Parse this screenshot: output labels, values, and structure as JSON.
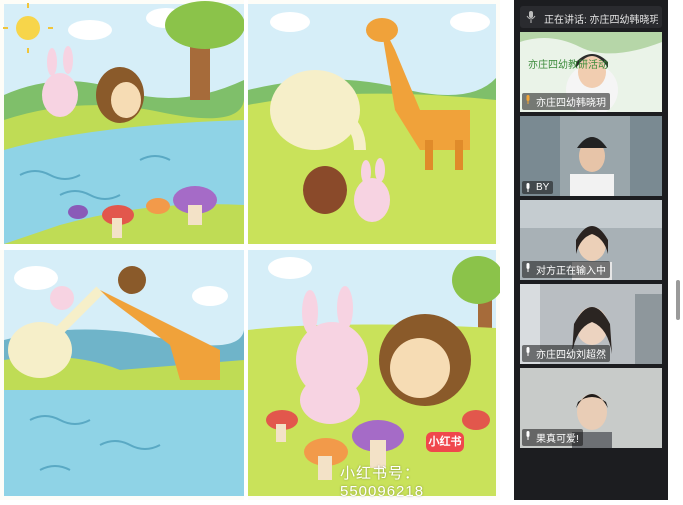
{
  "meeting": {
    "speaking_banner": "正在讲话: 亦庄四幼韩晓玥; 果...",
    "participants": [
      {
        "name": "亦庄四幼韩晓玥",
        "mic": "on"
      },
      {
        "name": "BY",
        "mic": "on"
      },
      {
        "name": "对方正在输入中",
        "mic": "on"
      },
      {
        "name": "亦庄四幼刘超然",
        "mic": "on"
      },
      {
        "name": "果真可爱!",
        "mic": "on"
      }
    ],
    "tile0_background_text": "亦庄四幼教研活动"
  },
  "shared_content": {
    "watermark_logo": "小红书",
    "watermark_text": "小红书号：550096218"
  },
  "colors": {
    "panel_bg": "#1c1d20",
    "sky": "#cfeaf5",
    "grass": "#b6d94a",
    "water": "#8fd3e6"
  }
}
